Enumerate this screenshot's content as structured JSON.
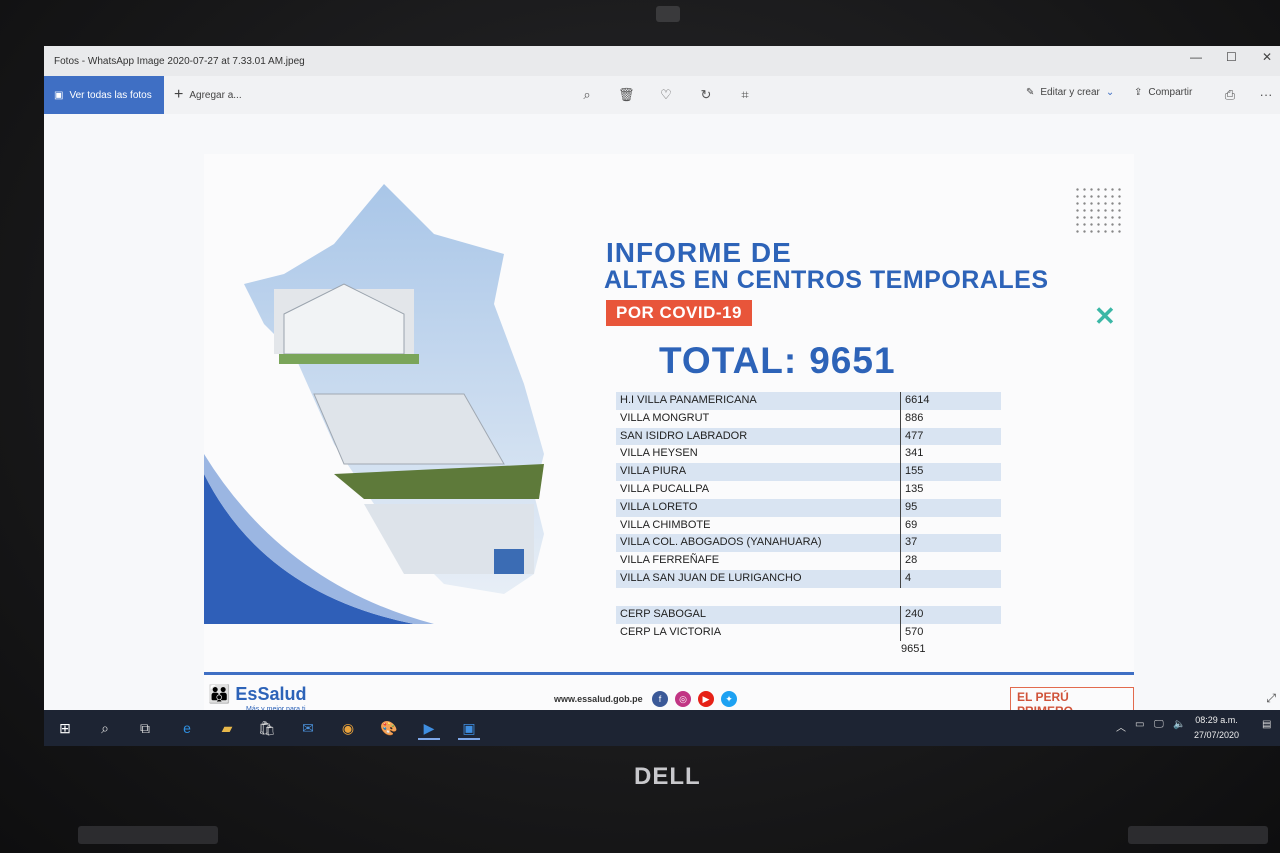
{
  "window": {
    "title": "Fotos - WhatsApp Image 2020-07-27 at 7.33.01 AM.jpeg",
    "controls": [
      "—",
      "☐",
      "✕"
    ]
  },
  "toolbar": {
    "all_photos": "Ver todas las fotos",
    "add_to": "Agregar a...",
    "edit_create": "Editar y crear",
    "share": "Compartir",
    "more": "···"
  },
  "slide": {
    "heading1": "INFORME DE",
    "heading2": "ALTAS EN CENTROS TEMPORALES",
    "tag": "POR COVID-19",
    "total_label": "TOTAL:",
    "total_value": "9651",
    "table": [
      {
        "name": "H.I VILLA PANAMERICANA",
        "value": "6614"
      },
      {
        "name": "VILLA MONGRUT",
        "value": "886"
      },
      {
        "name": "SAN ISIDRO LABRADOR",
        "value": "477"
      },
      {
        "name": "VILLA HEYSEN",
        "value": "341"
      },
      {
        "name": "VILLA PIURA",
        "value": "155"
      },
      {
        "name": "VILLA PUCALLPA",
        "value": "135"
      },
      {
        "name": "VILLA LORETO",
        "value": "95"
      },
      {
        "name": "VILLA CHIMBOTE",
        "value": "69"
      },
      {
        "name": "VILLA COL. ABOGADOS (YANAHUARA)",
        "value": "37"
      },
      {
        "name": "VILLA FERREÑAFE",
        "value": "28"
      },
      {
        "name": "VILLA SAN JUAN DE LURIGANCHO",
        "value": "4"
      }
    ],
    "table2": [
      {
        "name": "CERP SABOGAL",
        "value": "240"
      },
      {
        "name": "CERP LA VICTORIA",
        "value": "570"
      }
    ],
    "sum": "9651",
    "brand": "EsSalud",
    "brand_sub": "Más y mejor para ti",
    "website": "www.essalud.gob.pe",
    "peru_badge": "EL PERÚ PRIMERO"
  },
  "taskbar": {
    "time": "08:29 a.m.",
    "date": "27/07/2020"
  },
  "laptop_brand": "DELL",
  "colors": {
    "accent": "#3f6fc4",
    "heading": "#2d63b8",
    "covid_tag": "#e8553a",
    "row_shade": "#d9e4f2"
  }
}
